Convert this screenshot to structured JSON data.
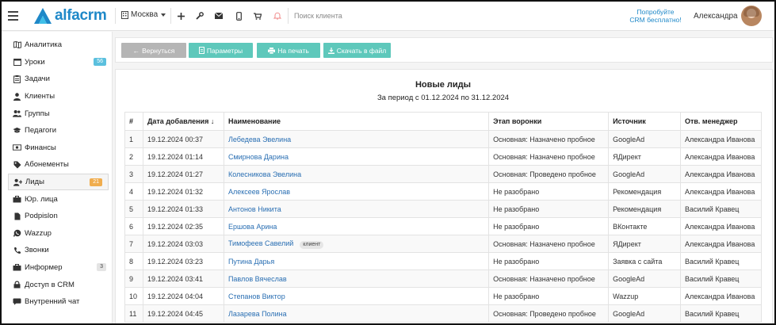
{
  "topbar": {
    "logo_text": "alfacrm",
    "city": "Москва",
    "search_placeholder": "Поиск клиента",
    "promo_line1": "Попробуйте",
    "promo_line2": "CRM бесплатно!",
    "user_name": "Александра"
  },
  "sidebar": {
    "items": [
      {
        "label": "Аналитика",
        "icon": "map-icon"
      },
      {
        "label": "Уроки",
        "icon": "calendar-icon",
        "badge": "56"
      },
      {
        "label": "Задачи",
        "icon": "clipboard-icon"
      },
      {
        "label": "Клиенты",
        "icon": "user-icon"
      },
      {
        "label": "Группы",
        "icon": "users-icon"
      },
      {
        "label": "Педагоги",
        "icon": "graduation-cap-icon"
      },
      {
        "label": "Финансы",
        "icon": "money-icon"
      },
      {
        "label": "Абонементы",
        "icon": "tag-icon"
      },
      {
        "label": "Лиды",
        "icon": "user-plus-icon",
        "badge": "21"
      },
      {
        "label": "Юр. лица",
        "icon": "briefcase-icon"
      },
      {
        "label": "Podpislon",
        "icon": "file-icon"
      },
      {
        "label": "Wazzup",
        "icon": "whatsapp-icon"
      },
      {
        "label": "Звонки",
        "icon": "phone-icon"
      },
      {
        "label": "Информер",
        "icon": "briefcase-icon",
        "badge": "3"
      },
      {
        "label": "Доступ в CRM",
        "icon": "lock-icon"
      },
      {
        "label": "Внутренний чат",
        "icon": "chat-icon"
      }
    ]
  },
  "toolbar": {
    "back": "Вернуться",
    "params": "Параметры",
    "print": "На печать",
    "download": "Скачать в файл"
  },
  "report": {
    "title": "Новые лиды",
    "period": "За период с 01.12.2024 по 31.12.2024",
    "columns": [
      "#",
      "Дата добавления ↓",
      "Наименование",
      "Этап воронки",
      "Источник",
      "Отв. менеджер"
    ],
    "rows": [
      {
        "n": "1",
        "date": "19.12.2024 00:37",
        "name": "Лебедева Эвелина",
        "stage": "Основная: Назначено пробное",
        "source": "GoogleAd",
        "manager": "Александра Иванова"
      },
      {
        "n": "2",
        "date": "19.12.2024 01:14",
        "name": "Смирнова Дарина",
        "stage": "Основная: Назначено пробное",
        "source": "ЯДирект",
        "manager": "Александра Иванова"
      },
      {
        "n": "3",
        "date": "19.12.2024 01:27",
        "name": "Колесникова Эвелина",
        "stage": "Основная: Проведено пробное",
        "source": "GoogleAd",
        "manager": "Александра Иванова"
      },
      {
        "n": "4",
        "date": "19.12.2024 01:32",
        "name": "Алексеев Ярослав",
        "stage": "Не разобрано",
        "source": "Рекомендация",
        "manager": "Александра Иванова"
      },
      {
        "n": "5",
        "date": "19.12.2024 01:33",
        "name": "Антонов Никита",
        "stage": "Не разобрано",
        "source": "Рекомендация",
        "manager": "Василий Кравец"
      },
      {
        "n": "6",
        "date": "19.12.2024 02:35",
        "name": "Ершова Арина",
        "stage": "Не разобрано",
        "source": "ВКонтакте",
        "manager": "Александра Иванова"
      },
      {
        "n": "7",
        "date": "19.12.2024 03:03",
        "name": "Тимофеев Савелий",
        "tag": "клиент",
        "stage": "Основная: Назначено пробное",
        "source": "ЯДирект",
        "manager": "Александра Иванова"
      },
      {
        "n": "8",
        "date": "19.12.2024 03:23",
        "name": "Путина Дарья",
        "stage": "Не разобрано",
        "source": "Заявка с сайта",
        "manager": "Василий Кравец"
      },
      {
        "n": "9",
        "date": "19.12.2024 03:41",
        "name": "Павлов Вячеслав",
        "stage": "Основная: Назначено пробное",
        "source": "GoogleAd",
        "manager": "Василий Кравец"
      },
      {
        "n": "10",
        "date": "19.12.2024 04:04",
        "name": "Степанов Виктор",
        "stage": "Не разобрано",
        "source": "Wazzup",
        "manager": "Александра Иванова"
      },
      {
        "n": "11",
        "date": "19.12.2024 04:45",
        "name": "Лазарева Полина",
        "stage": "Основная: Проведено пробное",
        "source": "GoogleAd",
        "manager": "Василий Кравец"
      }
    ]
  },
  "colors": {
    "brand": "#1e88c8",
    "button": "#5ec8bb",
    "link": "#2a6fb3",
    "badge_blue": "#5bc0de",
    "badge_orange": "#f0ad4e"
  }
}
